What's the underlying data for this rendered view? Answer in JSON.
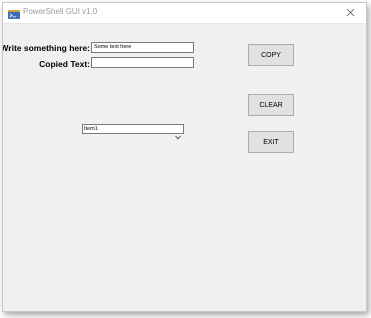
{
  "window": {
    "title": "PowerShell GUI v1.0"
  },
  "form": {
    "write_label": "Write something here:",
    "write_value": "Some text here",
    "copied_label": "Copied Text:",
    "copied_value": ""
  },
  "buttons": {
    "copy": "COPY",
    "clear": "CLEAR",
    "exit": "EXIT"
  },
  "dropdown": {
    "selected": "Item1"
  },
  "icons": {
    "app": "powershell-app-icon",
    "close": "close-icon",
    "dropdown": "chevron-down-icon"
  },
  "colors": {
    "window_bg": "#f0f0f0",
    "button_bg": "#e1e1e1",
    "button_border": "#adadad",
    "input_border": "#7a7a7a"
  }
}
